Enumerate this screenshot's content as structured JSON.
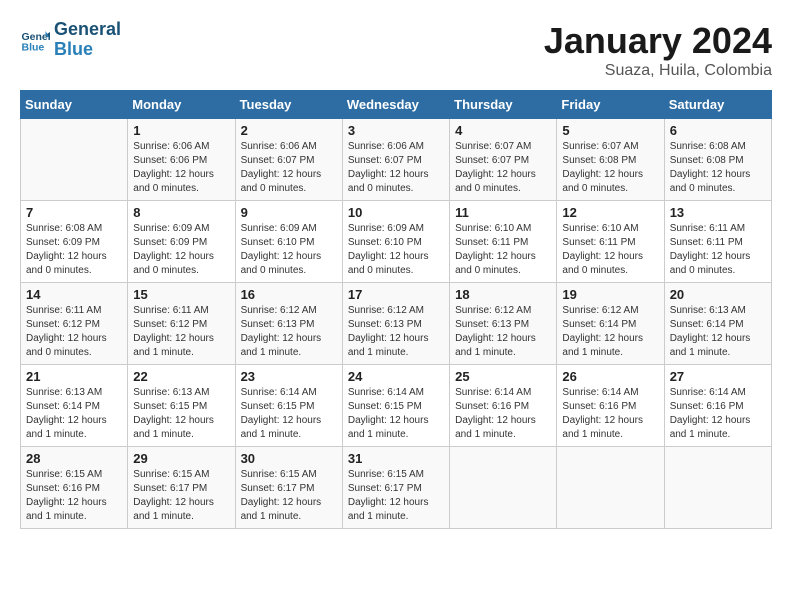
{
  "header": {
    "logo_general": "General",
    "logo_blue": "Blue",
    "month": "January 2024",
    "location": "Suaza, Huila, Colombia"
  },
  "weekdays": [
    "Sunday",
    "Monday",
    "Tuesday",
    "Wednesday",
    "Thursday",
    "Friday",
    "Saturday"
  ],
  "weeks": [
    [
      {
        "day": "",
        "info": ""
      },
      {
        "day": "1",
        "info": "Sunrise: 6:06 AM\nSunset: 6:06 PM\nDaylight: 12 hours\nand 0 minutes."
      },
      {
        "day": "2",
        "info": "Sunrise: 6:06 AM\nSunset: 6:07 PM\nDaylight: 12 hours\nand 0 minutes."
      },
      {
        "day": "3",
        "info": "Sunrise: 6:06 AM\nSunset: 6:07 PM\nDaylight: 12 hours\nand 0 minutes."
      },
      {
        "day": "4",
        "info": "Sunrise: 6:07 AM\nSunset: 6:07 PM\nDaylight: 12 hours\nand 0 minutes."
      },
      {
        "day": "5",
        "info": "Sunrise: 6:07 AM\nSunset: 6:08 PM\nDaylight: 12 hours\nand 0 minutes."
      },
      {
        "day": "6",
        "info": "Sunrise: 6:08 AM\nSunset: 6:08 PM\nDaylight: 12 hours\nand 0 minutes."
      }
    ],
    [
      {
        "day": "7",
        "info": "Sunrise: 6:08 AM\nSunset: 6:09 PM\nDaylight: 12 hours\nand 0 minutes."
      },
      {
        "day": "8",
        "info": "Sunrise: 6:09 AM\nSunset: 6:09 PM\nDaylight: 12 hours\nand 0 minutes."
      },
      {
        "day": "9",
        "info": "Sunrise: 6:09 AM\nSunset: 6:10 PM\nDaylight: 12 hours\nand 0 minutes."
      },
      {
        "day": "10",
        "info": "Sunrise: 6:09 AM\nSunset: 6:10 PM\nDaylight: 12 hours\nand 0 minutes."
      },
      {
        "day": "11",
        "info": "Sunrise: 6:10 AM\nSunset: 6:11 PM\nDaylight: 12 hours\nand 0 minutes."
      },
      {
        "day": "12",
        "info": "Sunrise: 6:10 AM\nSunset: 6:11 PM\nDaylight: 12 hours\nand 0 minutes."
      },
      {
        "day": "13",
        "info": "Sunrise: 6:11 AM\nSunset: 6:11 PM\nDaylight: 12 hours\nand 0 minutes."
      }
    ],
    [
      {
        "day": "14",
        "info": "Sunrise: 6:11 AM\nSunset: 6:12 PM\nDaylight: 12 hours\nand 0 minutes."
      },
      {
        "day": "15",
        "info": "Sunrise: 6:11 AM\nSunset: 6:12 PM\nDaylight: 12 hours\nand 1 minute."
      },
      {
        "day": "16",
        "info": "Sunrise: 6:12 AM\nSunset: 6:13 PM\nDaylight: 12 hours\nand 1 minute."
      },
      {
        "day": "17",
        "info": "Sunrise: 6:12 AM\nSunset: 6:13 PM\nDaylight: 12 hours\nand 1 minute."
      },
      {
        "day": "18",
        "info": "Sunrise: 6:12 AM\nSunset: 6:13 PM\nDaylight: 12 hours\nand 1 minute."
      },
      {
        "day": "19",
        "info": "Sunrise: 6:12 AM\nSunset: 6:14 PM\nDaylight: 12 hours\nand 1 minute."
      },
      {
        "day": "20",
        "info": "Sunrise: 6:13 AM\nSunset: 6:14 PM\nDaylight: 12 hours\nand 1 minute."
      }
    ],
    [
      {
        "day": "21",
        "info": "Sunrise: 6:13 AM\nSunset: 6:14 PM\nDaylight: 12 hours\nand 1 minute."
      },
      {
        "day": "22",
        "info": "Sunrise: 6:13 AM\nSunset: 6:15 PM\nDaylight: 12 hours\nand 1 minute."
      },
      {
        "day": "23",
        "info": "Sunrise: 6:14 AM\nSunset: 6:15 PM\nDaylight: 12 hours\nand 1 minute."
      },
      {
        "day": "24",
        "info": "Sunrise: 6:14 AM\nSunset: 6:15 PM\nDaylight: 12 hours\nand 1 minute."
      },
      {
        "day": "25",
        "info": "Sunrise: 6:14 AM\nSunset: 6:16 PM\nDaylight: 12 hours\nand 1 minute."
      },
      {
        "day": "26",
        "info": "Sunrise: 6:14 AM\nSunset: 6:16 PM\nDaylight: 12 hours\nand 1 minute."
      },
      {
        "day": "27",
        "info": "Sunrise: 6:14 AM\nSunset: 6:16 PM\nDaylight: 12 hours\nand 1 minute."
      }
    ],
    [
      {
        "day": "28",
        "info": "Sunrise: 6:15 AM\nSunset: 6:16 PM\nDaylight: 12 hours\nand 1 minute."
      },
      {
        "day": "29",
        "info": "Sunrise: 6:15 AM\nSunset: 6:17 PM\nDaylight: 12 hours\nand 1 minute."
      },
      {
        "day": "30",
        "info": "Sunrise: 6:15 AM\nSunset: 6:17 PM\nDaylight: 12 hours\nand 1 minute."
      },
      {
        "day": "31",
        "info": "Sunrise: 6:15 AM\nSunset: 6:17 PM\nDaylight: 12 hours\nand 1 minute."
      },
      {
        "day": "",
        "info": ""
      },
      {
        "day": "",
        "info": ""
      },
      {
        "day": "",
        "info": ""
      }
    ]
  ]
}
